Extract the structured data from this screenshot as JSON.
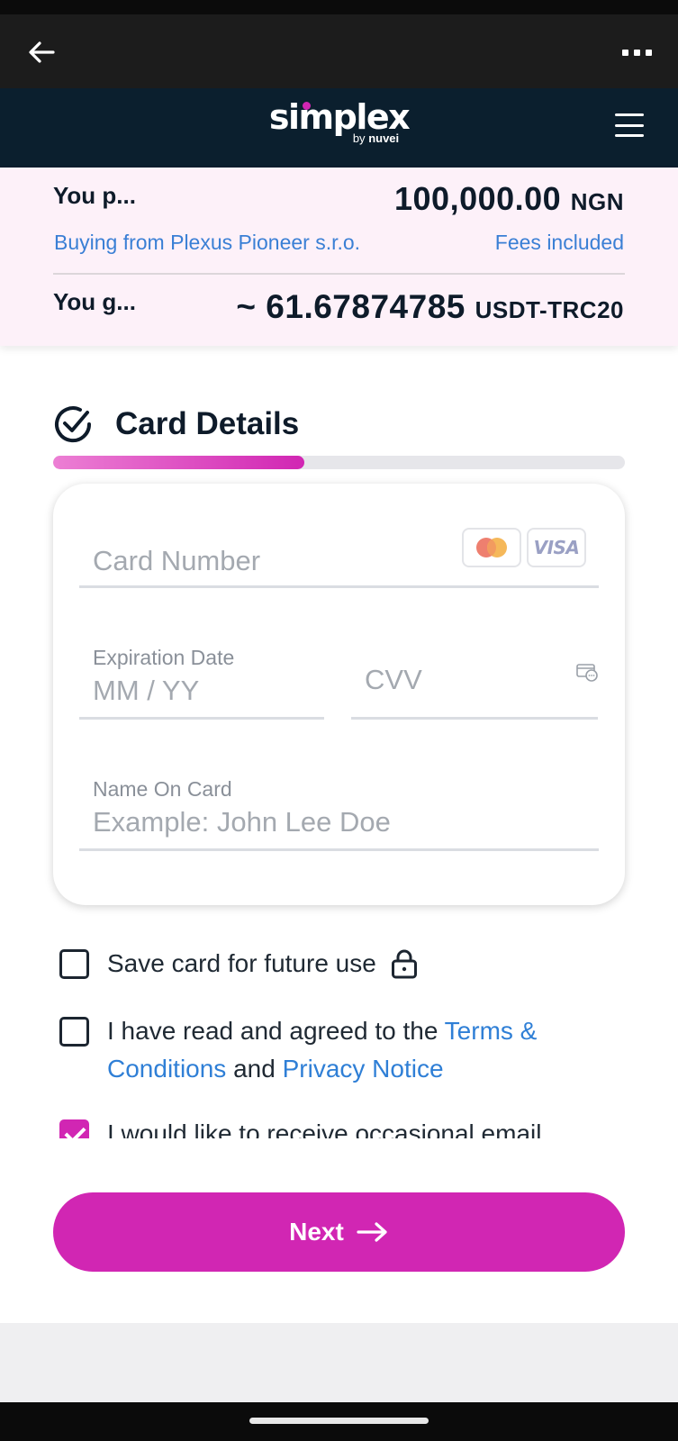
{
  "appbar": {
    "back_icon": "arrow-left-icon",
    "more_icon": "more-horizontal-icon"
  },
  "brand": {
    "logo_text": "simplex",
    "logo_by": "by",
    "logo_partner": "nuvei",
    "menu_icon": "hamburger-menu-icon",
    "accent_color": "#d126b3",
    "header_color": "#0b1f2e"
  },
  "summary": {
    "pay_label": "You p...",
    "pay_amount": "100,000.00",
    "pay_currency": "NGN",
    "buying_from": "Buying from Plexus Pioneer s.r.o.",
    "fees_text": "Fees included",
    "get_label": "You g...",
    "get_amount": "~ 61.67874785",
    "get_currency": "USDT-TRC20"
  },
  "step": {
    "title": "Card Details",
    "icon": "check-circle-icon",
    "progress": 0.44
  },
  "form": {
    "card_number_placeholder": "Card Number",
    "card_logos": [
      "mastercard-icon",
      "visa-icon"
    ],
    "visa_text": "VISA",
    "expiration_label": "Expiration Date",
    "expiration_placeholder": "MM / YY",
    "cvv_placeholder": "CVV",
    "cvv_icon": "card-cvv-icon",
    "name_label": "Name On Card",
    "name_placeholder": "Example: John Lee Doe"
  },
  "checkboxes": {
    "save_card": {
      "label": "Save card for future use",
      "checked": false,
      "icon": "lock-icon"
    },
    "terms": {
      "prefix": "I have read and agreed to the ",
      "terms_link": "Terms & Conditions",
      "middle": " and ",
      "privacy_link": "Privacy Notice",
      "checked": false
    },
    "email": {
      "label": "I would like to receive occasional email",
      "checked": true
    }
  },
  "actions": {
    "next_label": "Next",
    "next_icon": "arrow-right-icon"
  }
}
